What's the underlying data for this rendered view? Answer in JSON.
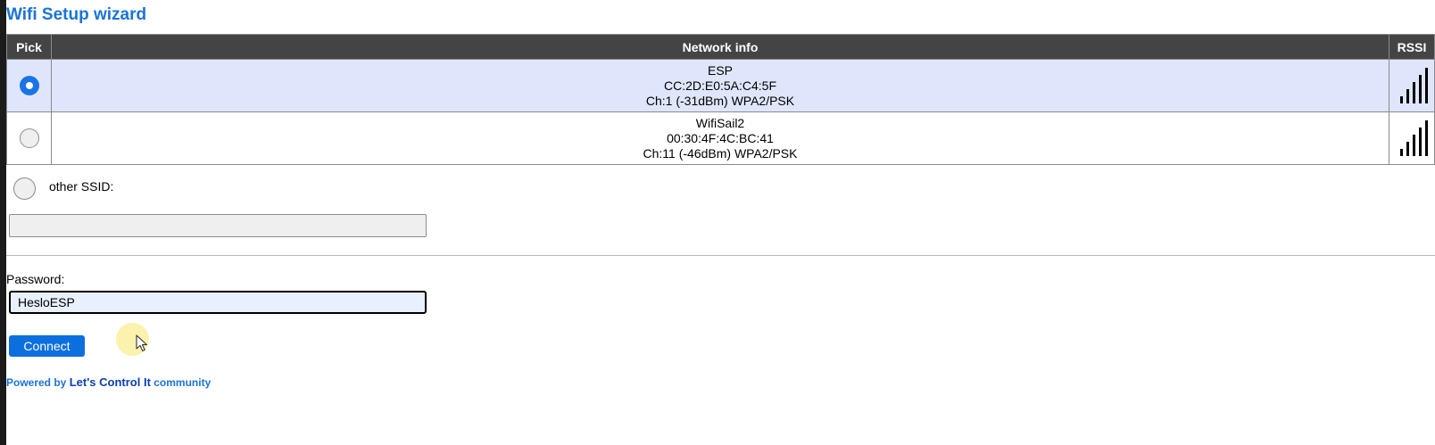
{
  "page": {
    "title": "Wifi Setup wizard"
  },
  "table": {
    "headers": {
      "pick": "Pick",
      "network_info": "Network info",
      "rssi": "RSSI"
    },
    "rows": [
      {
        "ssid": "ESP",
        "bssid": "CC:2D:E0:5A:C4:5F",
        "details": "Ch:1 (-31dBm) WPA2/PSK",
        "selected": true
      },
      {
        "ssid": "WifiSail2",
        "bssid": "00:30:4F:4C:BC:41",
        "details": "Ch:11 (-46dBm) WPA2/PSK",
        "selected": false
      }
    ]
  },
  "other_ssid": {
    "label": "other SSID:",
    "value": "",
    "selected": false
  },
  "password": {
    "label": "Password:",
    "value": "HesloESP"
  },
  "connect_button": {
    "label": "Connect"
  },
  "footer": {
    "powered_by": "Powered by",
    "brand": "Let's Control It",
    "community": "community"
  },
  "colors": {
    "accent": "#1a73d6",
    "header_bg": "#444444",
    "selected_row": "#dfe6fb",
    "button": "#0b6fde"
  },
  "icons": [
    "signal-strength-icon",
    "radio-selected-icon",
    "radio-unselected-icon",
    "mouse-cursor-icon"
  ]
}
